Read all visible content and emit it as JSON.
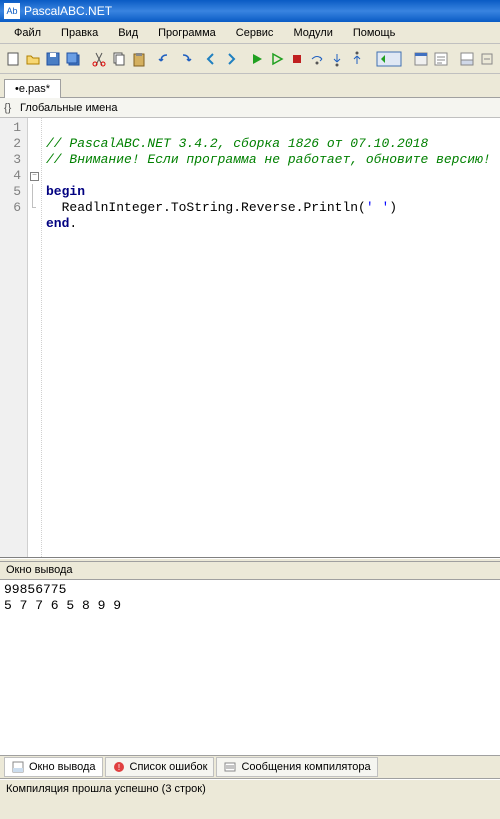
{
  "app_title": "PascalABC.NET",
  "menu": [
    "Файл",
    "Правка",
    "Вид",
    "Программа",
    "Сервис",
    "Модули",
    "Помощь"
  ],
  "tab_name": "•e.pas*",
  "namespace_label": "Глобальные имена",
  "line_numbers": [
    "1",
    "2",
    "3",
    "4",
    "5",
    "6"
  ],
  "code": {
    "l1": "// PascalABC.NET 3.4.2, сборка 1826 от 07.10.2018",
    "l2": "// Внимание! Если программа не работает, обновите версию!",
    "l4a": "begin",
    "l5": "  ReadlnInteger.ToString.Reverse.Println(",
    "l5_str": "' '",
    "l5_end": ")",
    "l6a": "end",
    "l6_dot": "."
  },
  "output_title": "Окно вывода",
  "output": {
    "line1": "99856775",
    "line2": "5 7 7 6 5 8 9 9"
  },
  "bottom_tabs": {
    "out": "Окно вывода",
    "err": "Список ошибок",
    "msg": "Сообщения компилятора"
  },
  "status": "Компиляция прошла успешно (3 строк)"
}
